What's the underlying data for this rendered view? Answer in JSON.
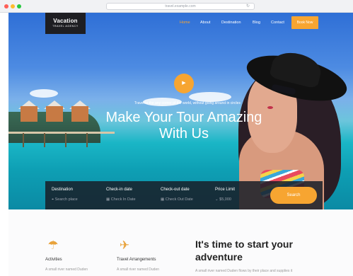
{
  "browser": {
    "url": "travel.example.com",
    "dots": [
      "#ff5f57",
      "#febc2e",
      "#28c840"
    ]
  },
  "brand": {
    "name": "Vacation",
    "tagline": "TRAVEL AGENCY"
  },
  "nav": {
    "items": [
      "Home",
      "About",
      "Destination",
      "Blog",
      "Contact"
    ],
    "active": "Home",
    "book_label": "Book Now"
  },
  "hero": {
    "tagline": "Travel to the any corner of the world, without going around in circles",
    "headline_line1": "Make Your Tour Amazing",
    "headline_line2": "With Us",
    "play_icon": "play-icon"
  },
  "search": {
    "fields": [
      {
        "label": "Destination",
        "placeholder": "Search place",
        "icon": "pin-icon"
      },
      {
        "label": "Check-in date",
        "placeholder": "Check In Date",
        "icon": "calendar-icon"
      },
      {
        "label": "Check-out date",
        "placeholder": "Check Out Date",
        "icon": "calendar-icon"
      },
      {
        "label": "Price Limit",
        "placeholder": "$5,000",
        "icon": "dollar-icon"
      }
    ],
    "button_label": "Search"
  },
  "features": [
    {
      "title": "Activities",
      "desc": "A small river named Duden",
      "icon": "activities-icon"
    },
    {
      "title": "Travel Arrangements",
      "desc": "A small river named Duden",
      "icon": "travel-arrangements-icon"
    }
  ],
  "adventure": {
    "title_line1": "It's time to start your",
    "title_line2": "adventure",
    "desc": "A small river named Duden flows by their place and supplies it"
  },
  "colors": {
    "accent": "#f7a531",
    "search_bg": "#1c212a",
    "logo_bg": "#1e1e22"
  }
}
